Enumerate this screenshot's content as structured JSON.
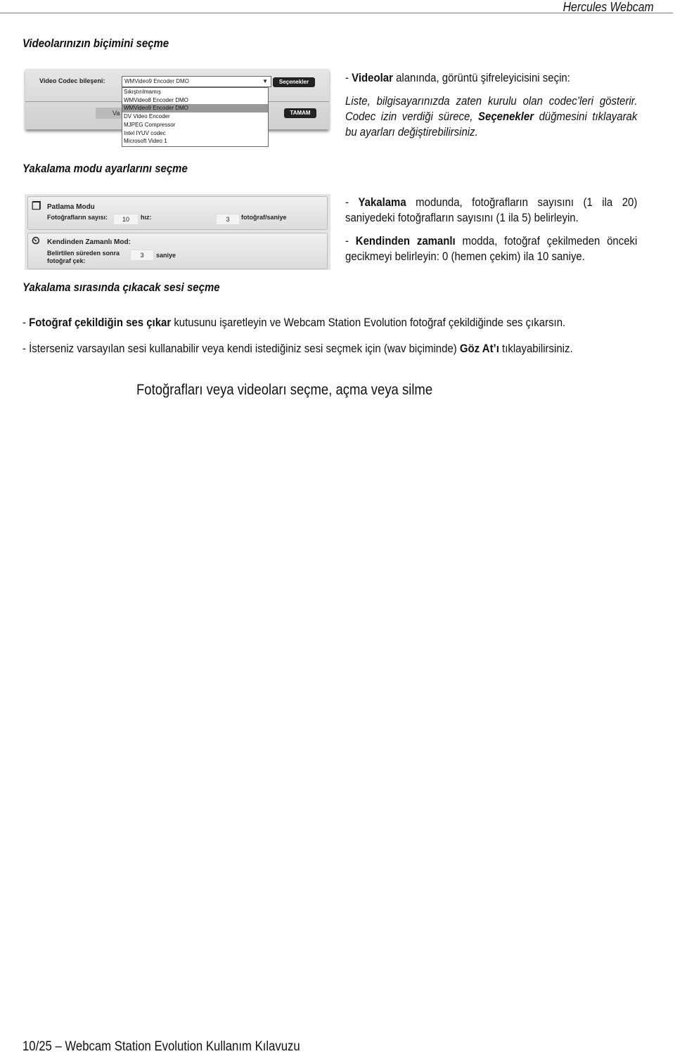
{
  "header": {
    "title": "Hercules Webcam"
  },
  "sections": [
    {
      "heading": "Videolarınızın biçimini seçme",
      "p1": {
        "prefix": "- ",
        "bold": "Videolar",
        "rest": " alanında, görüntü şifreleyicisini seçin:"
      },
      "p2": {
        "a": "Liste, bilgisayarınızda zaten kurulu olan codec’leri gösterir. Codec izin verdiği sürece, ",
        "bold": "Seçenekler",
        "b": " düğmesini tıklayarak bu ayarları değiştirebilirsiniz."
      }
    },
    {
      "heading": "Yakalama modu ayarlarını seçme",
      "p1": {
        "prefix": "- ",
        "bold": "Yakalama",
        "rest": " modunda, fotoğrafların sayısını (1 ila 20) saniyedeki fotoğrafların sayısını (1 ila 5) belirleyin."
      },
      "p2": {
        "prefix": "- ",
        "bold": "Kendinden zamanlı",
        "rest": " modda, fotoğraf çekilmeden önceki gecikmeyi belirleyin: 0 (hemen çekim) ila 10 saniye."
      }
    },
    {
      "heading": "Yakalama sırasında çıkacak sesi seçme",
      "p1": {
        "prefix": "- ",
        "bold": "Fotoğraf çekildiğin ses çıkar",
        "rest": " kutusunu işaretleyin ve Webcam Station Evolution fotoğraf çekildiğinde ses çıkarsın."
      },
      "p2": {
        "a": "- İsterseniz varsayılan sesi kullanabilir veya kendi istediğiniz sesi seçmek için (wav biçiminde) ",
        "bold": "Göz At’ı",
        "b": " tıklayabilirsiniz."
      }
    }
  ],
  "subtitle": "Fotoğrafları veya videoları seçme, açma veya silme",
  "codec_shot": {
    "label": "Video Codec bileşeni:",
    "selected": "WMVideo9 Encoder DMO",
    "options_button": "Seçenekler",
    "ok_button": "TAMAM",
    "hidden_button": "Va",
    "options": [
      "Sıkıştırılmamış",
      "WMVideo8 Encoder DMO",
      "WMVideo9 Encoder DMO",
      "DV Video Encoder",
      "MJPEG Compressor",
      "Intel IYUV codec",
      "Microsoft Video 1"
    ]
  },
  "mode_shot": {
    "burst_title": "Patlama Modu",
    "count_label": "Fotoğrafların sayısı:",
    "count": "10",
    "speed_label": "hız:",
    "speed": "3",
    "speed_unit": "fotoğraf/saniye",
    "timer_title": "Kendinden Zamanlı Mod:",
    "timer_label1": "Belirtilen süreden sonra",
    "timer_label2": "fotoğraf çek:",
    "timer": "3",
    "timer_unit": "saniye"
  },
  "footer": "10/25 – Webcam Station Evolution Kullanım Kılavuzu"
}
